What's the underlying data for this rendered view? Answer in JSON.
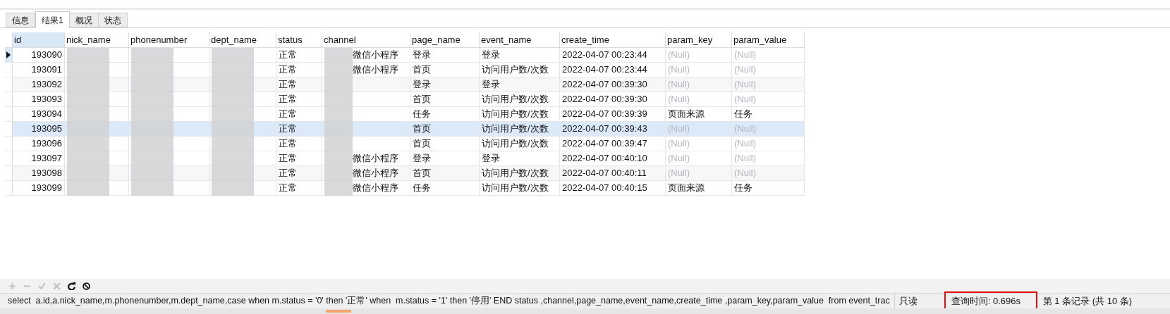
{
  "tabs": [
    {
      "label": "信息",
      "selected": false
    },
    {
      "label": "结果1",
      "selected": true
    },
    {
      "label": "概况",
      "selected": false
    },
    {
      "label": "状态",
      "selected": false
    }
  ],
  "table": {
    "columns": [
      {
        "label": "id",
        "selected": true
      },
      {
        "label": "nick_name",
        "selected": false
      },
      {
        "label": "phonenumber",
        "selected": false
      },
      {
        "label": "dept_name",
        "selected": false
      },
      {
        "label": "status",
        "selected": false
      },
      {
        "label": "channel",
        "selected": false
      },
      {
        "label": "page_name",
        "selected": false
      },
      {
        "label": "event_name",
        "selected": false
      },
      {
        "label": "create_time",
        "selected": false
      },
      {
        "label": "param_key",
        "selected": false
      },
      {
        "label": "param_value",
        "selected": false
      }
    ],
    "rows": [
      {
        "selected": true,
        "hovered": false,
        "cells": [
          "193090",
          "",
          "",
          "",
          "正常",
          "微信小程序",
          "登录",
          "登录",
          "2022-04-07 00:23:44",
          "(Null)",
          "(Null)"
        ]
      },
      {
        "selected": false,
        "hovered": false,
        "cells": [
          "193091",
          "",
          "",
          "",
          "正常",
          "微信小程序",
          "首页",
          "访问用户数/次数",
          "2022-04-07 00:23:44",
          "(Null)",
          "(Null)"
        ]
      },
      {
        "selected": false,
        "hovered": false,
        "cells": [
          "193092",
          "",
          "",
          "",
          "正常",
          "",
          "登录",
          "登录",
          "2022-04-07 00:39:30",
          "(Null)",
          "(Null)"
        ]
      },
      {
        "selected": false,
        "hovered": false,
        "cells": [
          "193093",
          "",
          "",
          "",
          "正常",
          "",
          "首页",
          "访问用户数/次数",
          "2022-04-07 00:39:30",
          "(Null)",
          "(Null)"
        ]
      },
      {
        "selected": false,
        "hovered": false,
        "cells": [
          "193094",
          "",
          "",
          "",
          "正常",
          "",
          "任务",
          "访问用户数/次数",
          "2022-04-07 00:39:39",
          "页面来源",
          "任务"
        ]
      },
      {
        "selected": false,
        "hovered": true,
        "cells": [
          "193095",
          "",
          "",
          "",
          "正常",
          "",
          "首页",
          "访问用户数/次数",
          "2022-04-07 00:39:43",
          "(Null)",
          "(Null)"
        ]
      },
      {
        "selected": false,
        "hovered": false,
        "cells": [
          "193096",
          "",
          "",
          "",
          "正常",
          "",
          "首页",
          "访问用户数/次数",
          "2022-04-07 00:39:47",
          "(Null)",
          "(Null)"
        ]
      },
      {
        "selected": false,
        "hovered": false,
        "cells": [
          "193097",
          "",
          "",
          "",
          "正常",
          "微信小程序",
          "登录",
          "登录",
          "2022-04-07 00:40:10",
          "(Null)",
          "(Null)"
        ]
      },
      {
        "selected": false,
        "hovered": false,
        "cells": [
          "193098",
          "",
          "",
          "",
          "正常",
          "微信小程序",
          "首页",
          "访问用户数/次数",
          "2022-04-07 00:40:11",
          "(Null)",
          "(Null)"
        ]
      },
      {
        "selected": false,
        "hovered": false,
        "cells": [
          "193099",
          "",
          "",
          "",
          "正常",
          "微信小程序",
          "任务",
          "访问用户数/次数",
          "2022-04-07 00:40:15",
          "页面来源",
          "任务"
        ]
      }
    ]
  },
  "toolbar": [
    {
      "disabled": true
    },
    {
      "disabled": true
    },
    {
      "disabled": true
    },
    {
      "disabled": true
    },
    {
      "disabled": false
    },
    {
      "disabled": false
    }
  ],
  "status_bar": {
    "sql": "select  a.id,a.nick_name,m.phonenumber,m.dept_name,case when m.status = '0' then '正常' when  m.status = '1' then '停用' END status ,channel,page_name,event_name,create_time ,param_key,param_value  from event_trac",
    "mode": "只读",
    "query_time": {
      "text": "查询时间: 0.696s",
      "highlighted": true
    },
    "record": "第 1 条记录 (共 10 条)"
  }
}
